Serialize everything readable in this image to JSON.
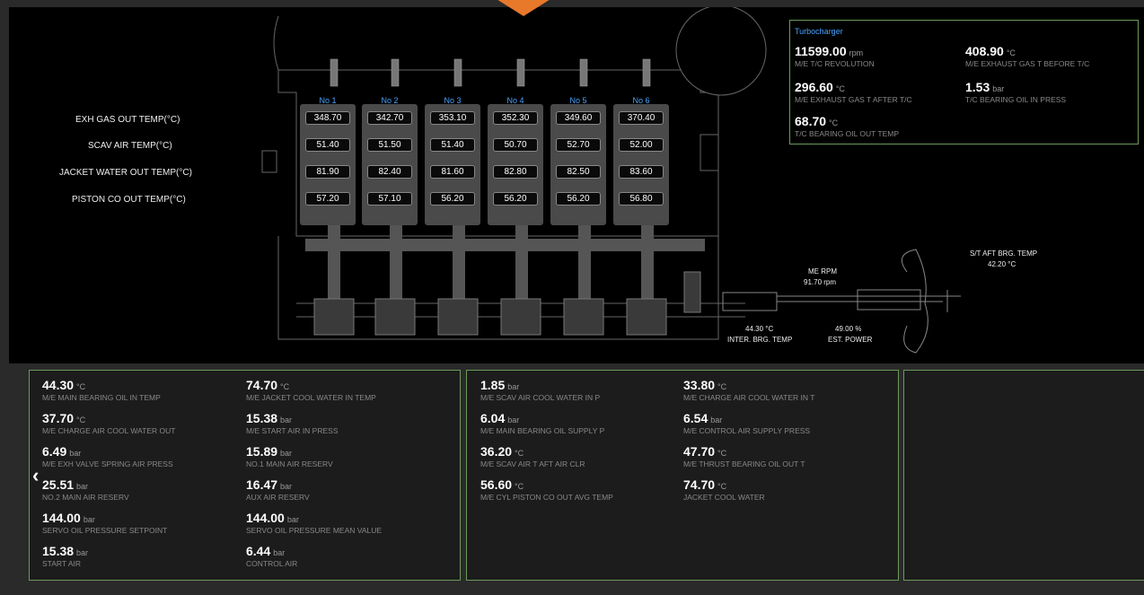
{
  "cylinders": {
    "headers": [
      "No 1",
      "No 2",
      "No 3",
      "No 4",
      "No 5",
      "No 6"
    ],
    "row_labels": [
      "EXH GAS OUT TEMP(°C)",
      "SCAV AIR TEMP(°C)",
      "JACKET WATER OUT TEMP(°C)",
      "PISTON CO OUT TEMP(°C)"
    ],
    "rows": [
      [
        "348.70",
        "342.70",
        "353.10",
        "352.30",
        "349.60",
        "370.40"
      ],
      [
        "51.40",
        "51.50",
        "51.40",
        "50.70",
        "52.70",
        "52.00"
      ],
      [
        "81.90",
        "82.40",
        "81.60",
        "82.80",
        "82.50",
        "83.60"
      ],
      [
        "57.20",
        "57.10",
        "56.20",
        "56.20",
        "56.20",
        "56.80"
      ]
    ]
  },
  "shaft": {
    "me_rpm_label": "ME RPM",
    "me_rpm_value": "91.70 rpm",
    "st_aft_label": "S/T AFT BRG. TEMP",
    "st_aft_value": "42.20 °C",
    "inter_value": "44.30 °C",
    "inter_label": "INTER. BRG. TEMP",
    "power_value": "49.00 %",
    "power_label": "EST. POWER"
  },
  "turbocharger": {
    "title": "Turbocharger",
    "metrics": [
      {
        "value": "11599.00",
        "unit": "rpm",
        "name": "M/E T/C REVOLUTION"
      },
      {
        "value": "408.90",
        "unit": "°C",
        "name": "M/E EXHAUST GAS T BEFORE T/C"
      },
      {
        "value": "296.60",
        "unit": "°C",
        "name": "M/E EXHAUST GAS T AFTER T/C"
      },
      {
        "value": "1.53",
        "unit": "bar",
        "name": "T/C BEARING OIL IN PRESS"
      },
      {
        "value": "68.70",
        "unit": "°C",
        "name": "T/C BEARING OIL OUT TEMP"
      }
    ]
  },
  "panel1": [
    {
      "value": "44.30",
      "unit": "°C",
      "name": "M/E MAIN BEARING OIL IN TEMP"
    },
    {
      "value": "74.70",
      "unit": "°C",
      "name": "M/E JACKET COOL WATER IN TEMP"
    },
    {
      "value": "37.70",
      "unit": "°C",
      "name": "M/E CHARGE AIR COOL WATER OUT"
    },
    {
      "value": "15.38",
      "unit": "bar",
      "name": "M/E START AIR IN PRESS"
    },
    {
      "value": "6.49",
      "unit": "bar",
      "name": "M/E EXH VALVE SPRING AIR PRESS"
    },
    {
      "value": "15.89",
      "unit": "bar",
      "name": "NO.1 MAIN AIR RESERV"
    },
    {
      "value": "25.51",
      "unit": "bar",
      "name": "NO.2 MAIN AIR RESERV"
    },
    {
      "value": "16.47",
      "unit": "bar",
      "name": "AUX AIR RESERV"
    },
    {
      "value": "144.00",
      "unit": "bar",
      "name": "SERVO OIL PRESSURE SETPOINT"
    },
    {
      "value": "144.00",
      "unit": "bar",
      "name": "SERVO OIL PRESSURE MEAN VALUE"
    },
    {
      "value": "15.38",
      "unit": "bar",
      "name": "START AIR"
    },
    {
      "value": "6.44",
      "unit": "bar",
      "name": "CONTROL AIR"
    }
  ],
  "panel2": [
    {
      "value": "1.85",
      "unit": "bar",
      "name": "M/E SCAV AIR COOL WATER IN P"
    },
    {
      "value": "33.80",
      "unit": "°C",
      "name": "M/E CHARGE AIR COOL WATER IN T"
    },
    {
      "value": "6.04",
      "unit": "bar",
      "name": "M/E MAIN BEARING OIL SUPPLY P"
    },
    {
      "value": "6.54",
      "unit": "bar",
      "name": "M/E CONTROL AIR SUPPLY PRESS"
    },
    {
      "value": "36.20",
      "unit": "°C",
      "name": "M/E SCAV AIR T AFT AIR CLR"
    },
    {
      "value": "47.70",
      "unit": "°C",
      "name": "M/E THRUST BEARING OIL OUT T"
    },
    {
      "value": "56.60",
      "unit": "°C",
      "name": "M/E CYL PISTON CO OUT AVG TEMP"
    },
    {
      "value": "74.70",
      "unit": "°C",
      "name": "JACKET COOL WATER"
    }
  ],
  "nav": {
    "prev_glyph": "‹"
  },
  "colors": {
    "accent_blue": "#4aa3ff",
    "panel_border": "#6b9a5a",
    "orange": "#e8792b"
  }
}
